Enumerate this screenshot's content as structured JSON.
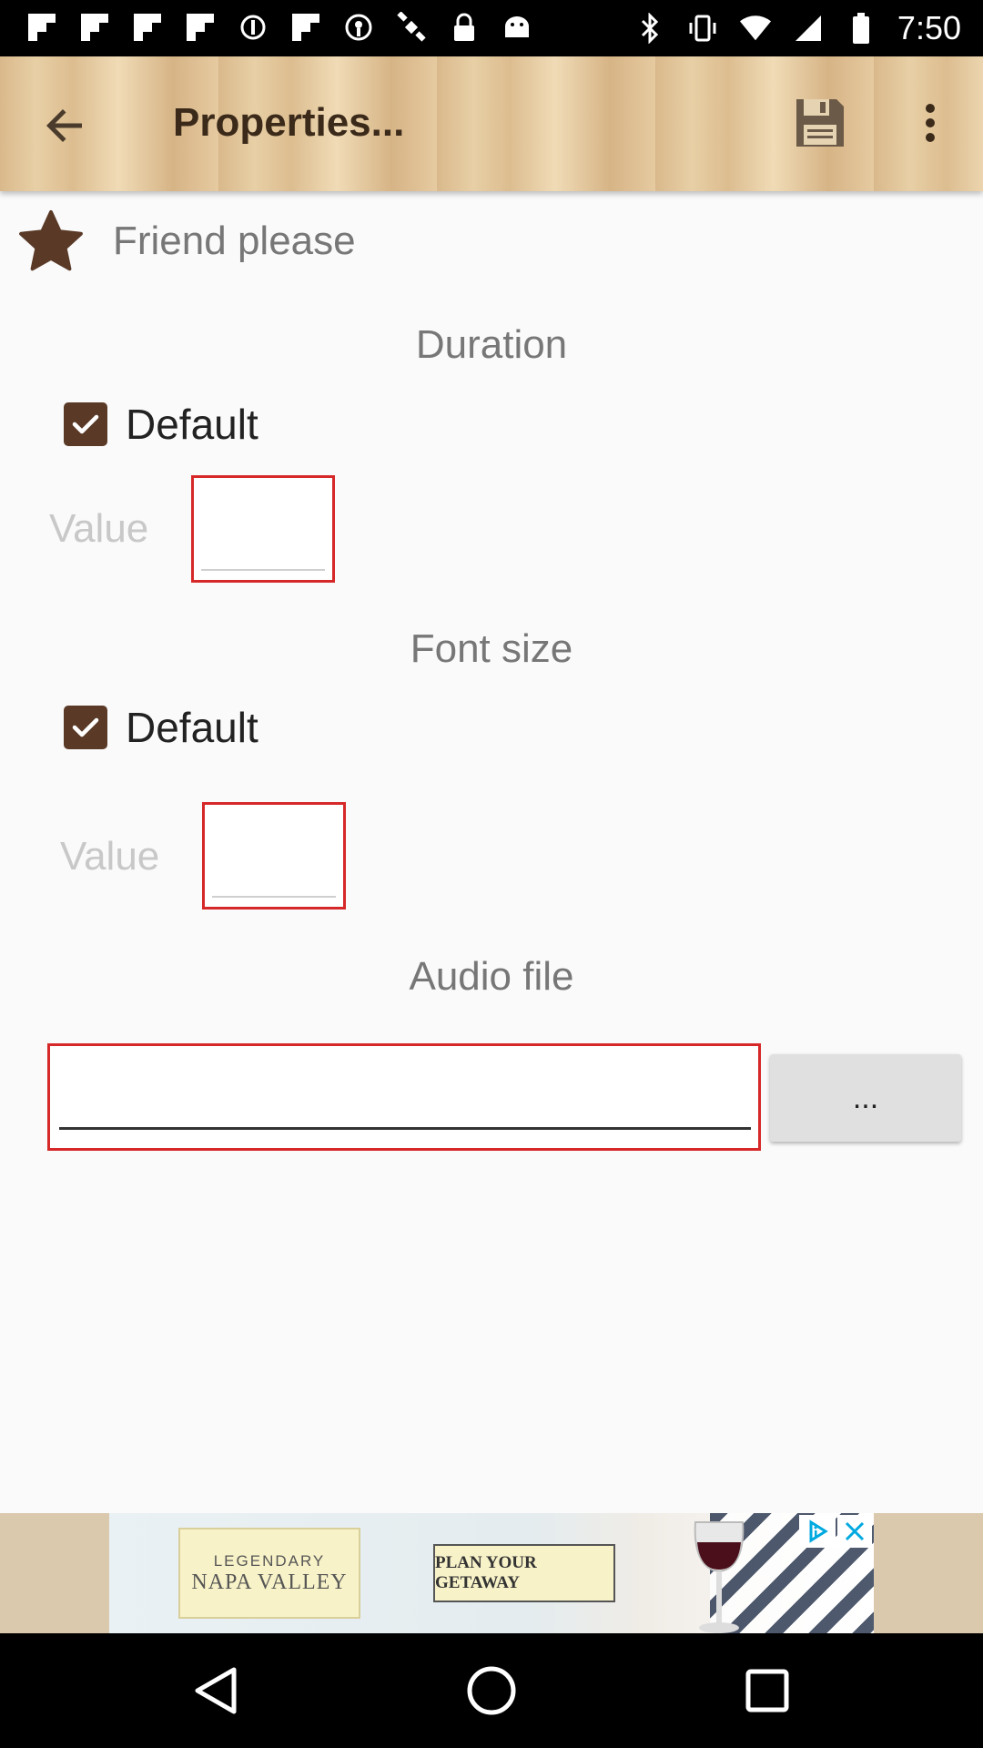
{
  "status_bar": {
    "time": "7:50",
    "left_icons": [
      "flipboard-icon",
      "flipboard-icon",
      "flipboard-icon",
      "flipboard-icon",
      "sync-icon",
      "flipboard-icon",
      "podcast-icon",
      "satellite-icon",
      "lock-icon",
      "android-icon"
    ],
    "right_icons": [
      "bluetooth-icon",
      "vibrate-icon",
      "wifi-icon",
      "signal-icon",
      "battery-icon"
    ]
  },
  "app_bar": {
    "title": "Properties...",
    "back_icon": "arrow-back-icon",
    "save_icon": "floppy-disk-icon",
    "more_icon": "more-vert-icon"
  },
  "item": {
    "icon": "star-icon",
    "name": "Friend please"
  },
  "duration": {
    "title": "Duration",
    "default_label": "Default",
    "default_checked": true,
    "value_label": "Value",
    "value": ""
  },
  "font_size": {
    "title": "Font size",
    "default_label": "Default",
    "default_checked": true,
    "value_label": "Value",
    "value": ""
  },
  "audio_file": {
    "title": "Audio file",
    "value": "",
    "browse_label": "..."
  },
  "ad": {
    "logo_line1": "LEGENDARY",
    "logo_line2": "NAPA VALLEY",
    "cta": "PLAN YOUR GETAWAY"
  },
  "colors": {
    "brand_brown": "#5a3a27",
    "error_red": "#d62828",
    "wood_light": "#e8cfa5"
  }
}
